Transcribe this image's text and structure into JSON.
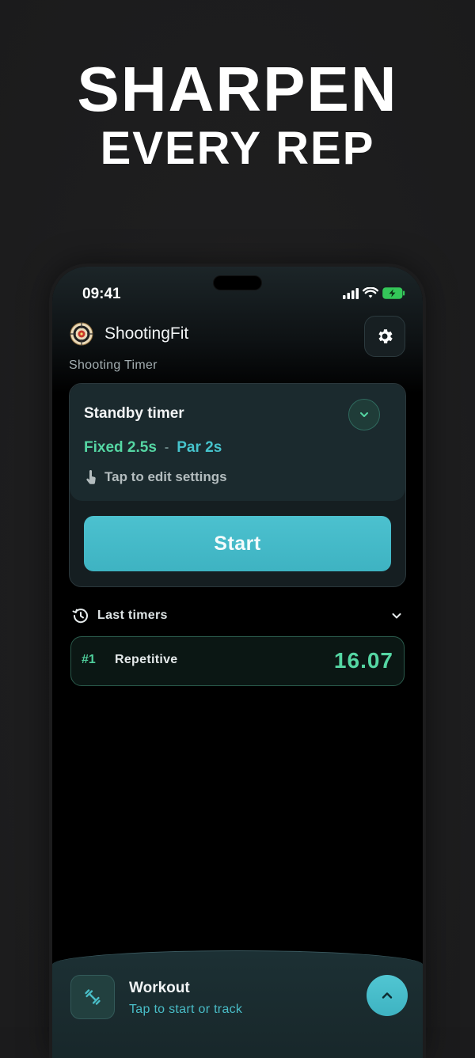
{
  "promo": {
    "line1": "SHARPEN",
    "line2": "EVERY REP"
  },
  "status_bar": {
    "time": "09:41",
    "icons": [
      "signal-icon",
      "wifi-icon",
      "battery-charging-icon"
    ]
  },
  "app": {
    "name": "ShootingFit",
    "subtitle": "Shooting Timer",
    "logo_icon": "target-icon",
    "settings_icon": "gear-icon"
  },
  "timer_card": {
    "title": "Standby timer",
    "mode_fixed": "Fixed 2.5s",
    "mode_separator": "-",
    "mode_par": "Par 2s",
    "edit_hint": "Tap to edit settings",
    "start_label": "Start"
  },
  "last_timers": {
    "title": "Last timers",
    "items": [
      {
        "rank": "#1",
        "name": "Repetitive",
        "time": "16.07"
      }
    ]
  },
  "workout_bar": {
    "title": "Workout",
    "subtitle": "Tap to start or track",
    "icon": "dumbbell-icon"
  },
  "colors": {
    "accent_teal": "#46c3cc",
    "accent_green": "#55d6a3",
    "background": "#000000"
  }
}
